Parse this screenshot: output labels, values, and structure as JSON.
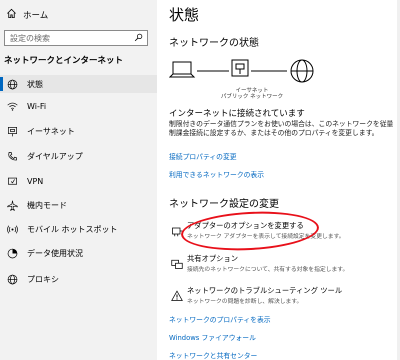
{
  "sidebar": {
    "home_label": "ホーム",
    "search_placeholder": "設定の検索",
    "section_heading": "ネットワークとインターネット",
    "items": [
      {
        "label": "状態",
        "icon": "globe-icon",
        "selected": true
      },
      {
        "label": "Wi-Fi",
        "icon": "wifi-icon",
        "selected": false
      },
      {
        "label": "イーサネット",
        "icon": "ethernet-icon",
        "selected": false
      },
      {
        "label": "ダイヤルアップ",
        "icon": "phone-icon",
        "selected": false
      },
      {
        "label": "VPN",
        "icon": "vpn-icon",
        "selected": false
      },
      {
        "label": "機内モード",
        "icon": "airplane-icon",
        "selected": false
      },
      {
        "label": "モバイル ホットスポット",
        "icon": "hotspot-icon",
        "selected": false
      },
      {
        "label": "データ使用状況",
        "icon": "data-usage-icon",
        "selected": false
      },
      {
        "label": "プロキシ",
        "icon": "globe-icon",
        "selected": false
      }
    ]
  },
  "main": {
    "title": "状態",
    "network_status_heading": "ネットワークの状態",
    "diagram": {
      "label_line1": "イーサネット",
      "label_line2": "パブリック ネットワーク"
    },
    "connected_heading": "インターネットに接続されています",
    "connected_desc": "制限付きのデータ通信プランをお使いの場合は、このネットワークを従量制課金接続に設定するか、またはその他のプロパティを変更します。",
    "link_change_props": "接続プロパティの変更",
    "link_show_networks": "利用できるネットワークの表示",
    "settings_heading": "ネットワーク設定の変更",
    "options": [
      {
        "title": "アダプターのオプションを変更する",
        "desc": "ネットワーク アダプターを表示して接続設定を変更します。",
        "icon": "adapter-icon"
      },
      {
        "title": "共有オプション",
        "desc": "接続先のネットワークについて、共有する対象を指定します。",
        "icon": "sharing-icon"
      },
      {
        "title": "ネットワークのトラブルシューティング ツール",
        "desc": "ネットワークの問題を診断し、解決します。",
        "icon": "warning-icon"
      }
    ],
    "link_view_props": "ネットワークのプロパティを表示",
    "link_firewall": "Windows ファイアウォール",
    "link_sharing_center": "ネットワークと共有センター"
  },
  "colors": {
    "accent": "#0067c0",
    "highlight": "#e8101a",
    "sidebar_bg": "#f2f2f2"
  }
}
